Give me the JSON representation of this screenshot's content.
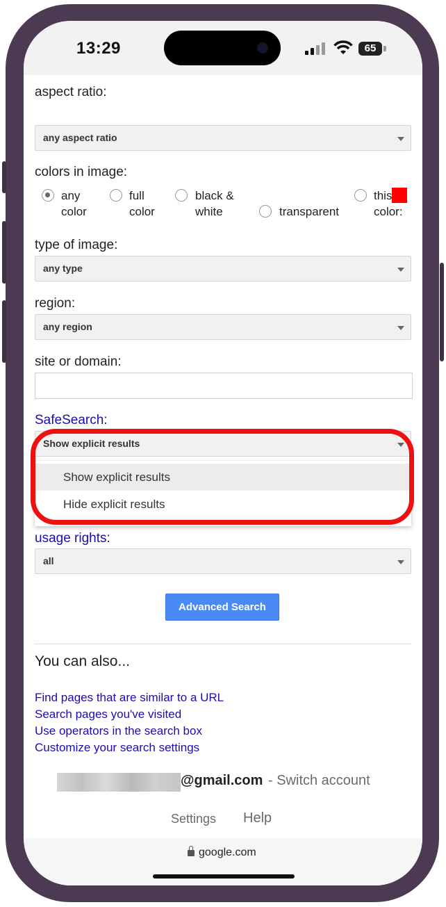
{
  "status_bar": {
    "time": "13:29",
    "battery": "65"
  },
  "form": {
    "aspect_ratio": {
      "label": "aspect ratio:",
      "value": "any aspect ratio"
    },
    "colors": {
      "label": "colors in image:",
      "options": [
        {
          "line1": "any",
          "line2": "color",
          "checked": true
        },
        {
          "line1": "full",
          "line2": "color",
          "checked": false
        },
        {
          "line1": "black &",
          "line2": "white",
          "checked": false
        },
        {
          "line1": "transparent",
          "checked": false
        },
        {
          "line1": "this",
          "line2": "color:",
          "checked": false
        }
      ],
      "swatch_color": "#ff0000"
    },
    "type_of_image": {
      "label": "type of image:",
      "value": "any type"
    },
    "region": {
      "label": "region:",
      "value": "any region"
    },
    "site": {
      "label": "site or domain:",
      "value": ""
    },
    "safesearch": {
      "label": "SafeSearch:",
      "value": "Show explicit results",
      "options": [
        "Show explicit results",
        "Hide explicit results"
      ],
      "highlight_color": "#ee1111"
    },
    "usage_rights": {
      "label": "usage rights:",
      "value": "all"
    },
    "submit_label": "Advanced Search"
  },
  "also": {
    "heading": "You can also...",
    "links": [
      "Find pages that are similar to a URL",
      "Search pages you've visited",
      "Use operators in the search box",
      "Customize your search settings"
    ]
  },
  "account": {
    "email_suffix": "@gmail.com",
    "switch_text": "- Switch account"
  },
  "footer": {
    "settings": "Settings",
    "help": "Help"
  },
  "browser": {
    "url": "google.com"
  }
}
